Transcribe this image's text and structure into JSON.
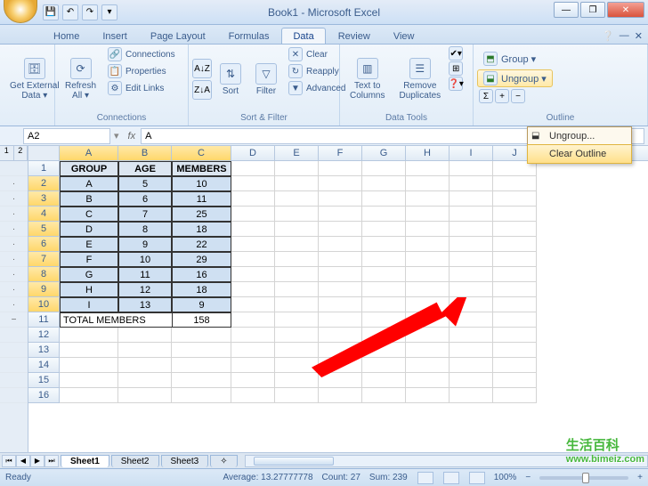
{
  "title": "Book1 - Microsoft Excel",
  "tabs": [
    "Home",
    "Insert",
    "Page Layout",
    "Formulas",
    "Data",
    "Review",
    "View"
  ],
  "active_tab": "Data",
  "ribbon": {
    "get_external": "Get External\nData ▾",
    "refresh": "Refresh\nAll ▾",
    "connections": "Connections",
    "properties": "Properties",
    "edit_links": "Edit Links",
    "conn_group": "Connections",
    "sort": "Sort",
    "filter": "Filter",
    "clear": "Clear",
    "reapply": "Reapply",
    "advanced": "Advanced",
    "sf_group": "Sort & Filter",
    "t2c": "Text to\nColumns",
    "rdup": "Remove\nDuplicates",
    "dt_group": "Data Tools",
    "group_btn": "Group ▾",
    "ungroup_btn": "Ungroup ▾",
    "outline_group": "Outline"
  },
  "dropdown": {
    "ungroup": "Ungroup...",
    "clear_outline": "Clear Outline"
  },
  "namebox": "A2",
  "formula": "A",
  "columns": [
    "A",
    "B",
    "C",
    "D",
    "E",
    "F",
    "G",
    "H",
    "I",
    "J"
  ],
  "headers": {
    "A": "GROUP",
    "B": "AGE",
    "C": "MEMBERS"
  },
  "data_rows": [
    {
      "r": 2,
      "A": "A",
      "B": "5",
      "C": "10"
    },
    {
      "r": 3,
      "A": "B",
      "B": "6",
      "C": "11"
    },
    {
      "r": 4,
      "A": "C",
      "B": "7",
      "C": "25"
    },
    {
      "r": 5,
      "A": "D",
      "B": "8",
      "C": "18"
    },
    {
      "r": 6,
      "A": "E",
      "B": "9",
      "C": "22"
    },
    {
      "r": 7,
      "A": "F",
      "B": "10",
      "C": "29"
    },
    {
      "r": 8,
      "A": "G",
      "B": "11",
      "C": "16"
    },
    {
      "r": 9,
      "A": "H",
      "B": "12",
      "C": "18"
    },
    {
      "r": 10,
      "A": "I",
      "B": "13",
      "C": "9"
    }
  ],
  "total_row": {
    "r": 11,
    "label": "TOTAL MEMBERS",
    "value": "158"
  },
  "sheets": [
    "Sheet1",
    "Sheet2",
    "Sheet3"
  ],
  "status": {
    "ready": "Ready",
    "average": "Average: 13.27777778",
    "count": "Count: 27",
    "sum": "Sum: 239",
    "zoom": "100%"
  },
  "watermark": {
    "cn": "生活百科",
    "url": "www.bimeiz.com"
  }
}
